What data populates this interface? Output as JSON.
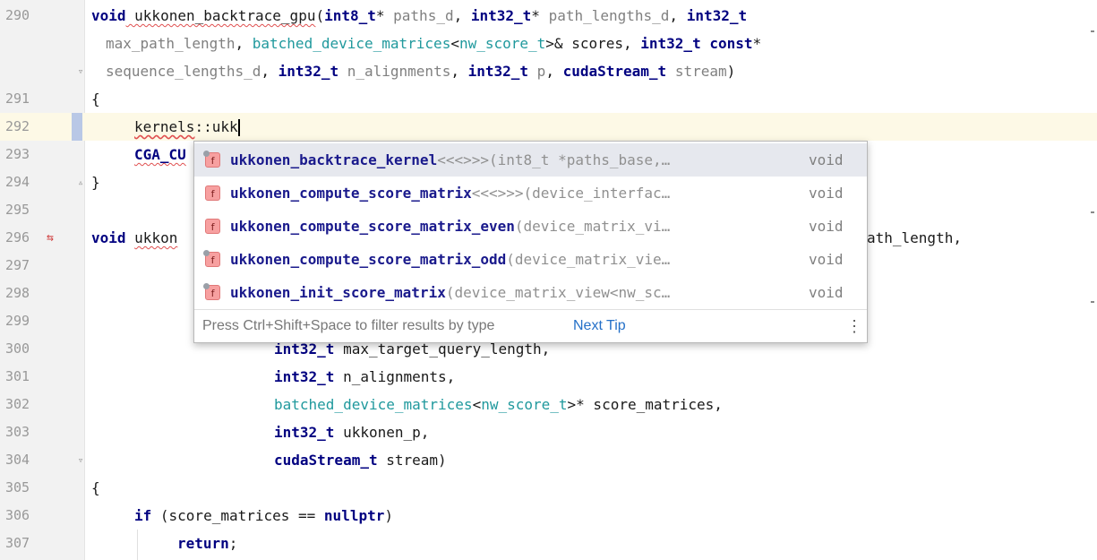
{
  "editor": {
    "line_numbers": [
      "290",
      "",
      "",
      "291",
      "292",
      "293",
      "294",
      "295",
      "296",
      "297",
      "298",
      "299",
      "300",
      "301",
      "302",
      "303",
      "304",
      "305",
      "306",
      "307"
    ],
    "code": {
      "l290_a": "void",
      "l290_b": " ukkonen_backtrace_gpu",
      "l290_c": "(",
      "l290_d": "int8_t",
      "l290_e": "* ",
      "l290_f": "paths_d",
      "l290_g": ", ",
      "l290_h": "int32_t",
      "l290_i": "* ",
      "l290_j": "path_lengths_d",
      "l290_k": ", ",
      "l290_l": "int32_t",
      "l290b_a": "max_path_length",
      "l290b_b": ", ",
      "l290b_c": "batched_device_matrices",
      "l290b_d": "<",
      "l290b_e": "nw_score_t",
      "l290b_f": ">& scores, ",
      "l290b_g": "int32_t",
      "l290b_h": " ",
      "l290b_i": "const",
      "l290b_j": "*",
      "l290c_a": "sequence_lengths_d",
      "l290c_b": ", ",
      "l290c_c": "int32_t",
      "l290c_d": " ",
      "l290c_e": "n_alignments",
      "l290c_f": ", ",
      "l290c_g": "int32_t",
      "l290c_h": " ",
      "l290c_i": "p",
      "l290c_j": ", ",
      "l290c_k": "cudaStream_t",
      "l290c_l": " ",
      "l290c_m": "stream",
      "l290c_n": ")",
      "l291": "{",
      "l292_a": "kernels",
      "l292_b": "::ukk",
      "l293": "CGA_CU",
      "l294": "}",
      "l296_a": "void",
      "l296_b": "ukkon",
      "l296_tail": "ath_length,",
      "l300_a": "int32_t",
      "l300_b": " max_target_query_length,",
      "l301_a": "int32_t",
      "l301_b": " n_alignments,",
      "l302_a": "batched_device_matrices",
      "l302_b": "<",
      "l302_c": "nw_score_t",
      "l302_d": ">* score_matrices,",
      "l303_a": "int32_t",
      "l303_b": " ukkonen_p,",
      "l304_a": "cudaStream_t",
      "l304_b": " stream)",
      "l305": "{",
      "l306_a": "if",
      "l306_b": " (score_matrices == ",
      "l306_c": "nullptr",
      "l306_d": ")",
      "l307_a": "return",
      "l307_b": ";"
    }
  },
  "completion": {
    "badge": "f",
    "items": [
      {
        "match": "ukk",
        "rest": "onen_backtrace_kernel",
        "sig": "<<<>>>(int8_t *paths_base,…",
        "type": "void"
      },
      {
        "match": "ukk",
        "rest": "onen_compute_score_matrix",
        "sig": "<<<>>>(device_interfac…",
        "type": "void"
      },
      {
        "match": "ukk",
        "rest": "onen_compute_score_matrix_even",
        "sig": "(device_matrix_vi…",
        "type": "void"
      },
      {
        "match": "ukk",
        "rest": "onen_compute_score_matrix_odd",
        "sig": "(device_matrix_vie…",
        "type": "void"
      },
      {
        "match": "ukk",
        "rest": "onen_init_score_matrix",
        "sig": "(device_matrix_view<nw_sc…",
        "type": "void"
      }
    ],
    "footer_tip": "Press Ctrl+Shift+Space to filter results by type",
    "next_tip": "Next Tip",
    "more_icon": "⋮"
  },
  "colors": {
    "keyword": "#000080",
    "type": "#20999d",
    "param": "#808080",
    "selection": "#e6e8ee",
    "current_line": "#fdf9e6"
  }
}
